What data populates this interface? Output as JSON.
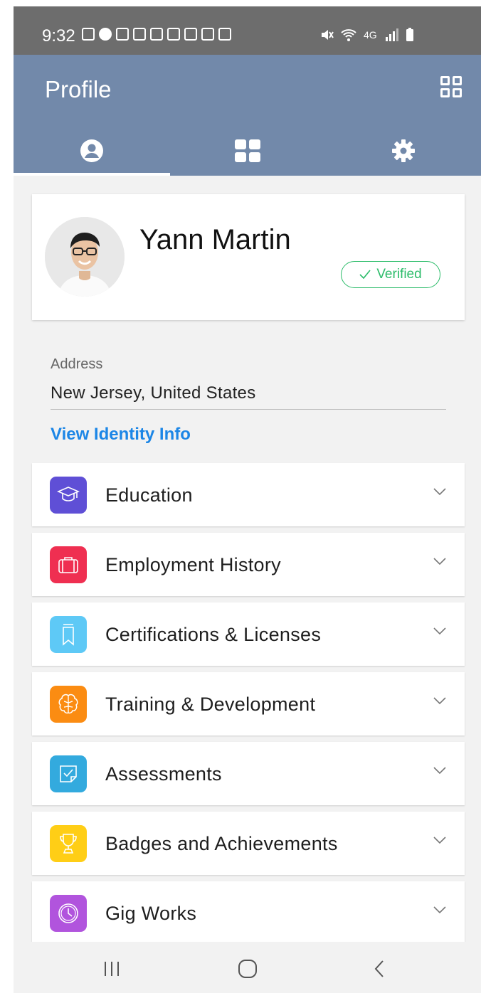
{
  "status_bar": {
    "time": "9:32",
    "network": "4G"
  },
  "header": {
    "title": "Profile"
  },
  "tabs": [
    {
      "name": "profile",
      "icon": "user-circle-icon",
      "active": true
    },
    {
      "name": "dashboard",
      "icon": "grid-icon",
      "active": false
    },
    {
      "name": "settings",
      "icon": "gear-icon",
      "active": false
    }
  ],
  "profile": {
    "name": "Yann Martin",
    "badge": "Verified"
  },
  "address": {
    "label": "Address",
    "value": "New Jersey, United States"
  },
  "identity_link": "View Identity Info",
  "sections": [
    {
      "label": "Education",
      "color": "#5f4fd6",
      "icon": "graduation-cap-icon"
    },
    {
      "label": "Employment History",
      "color": "#ef2f51",
      "icon": "briefcase-icon"
    },
    {
      "label": "Certifications & Licenses",
      "color": "#5ec9f6",
      "icon": "bookmark-icon"
    },
    {
      "label": "Training & Development",
      "color": "#fb8c12",
      "icon": "brain-icon"
    },
    {
      "label": "Assessments",
      "color": "#33aade",
      "icon": "checklist-icon"
    },
    {
      "label": "Badges and Achievements",
      "color": "#ffce16",
      "icon": "trophy-icon"
    },
    {
      "label": "Gig Works",
      "color": "#b154dd",
      "icon": "clock-icon"
    }
  ],
  "colors": {
    "header": "#7289aa",
    "link": "#1c86e6",
    "verified": "#2cbc6a",
    "background": "#f2f2f2"
  }
}
